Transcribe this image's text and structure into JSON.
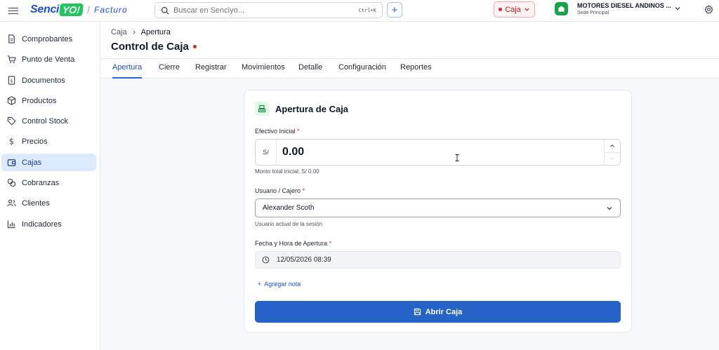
{
  "topbar": {
    "logo_text": "Senci",
    "logo_badge": "YO!",
    "logo_product": "Facturo",
    "search_placeholder": "Buscar en Senciyo...",
    "search_shortcut": "Ctrl+K",
    "caja_status": "Caja",
    "company_name": "MOTORES DIESEL ANDINOS ...",
    "company_branch": "Sede Principal"
  },
  "sidebar": {
    "items": [
      {
        "label": "Comprobantes",
        "icon": "file-text-icon"
      },
      {
        "label": "Punto de Venta",
        "icon": "cart-icon"
      },
      {
        "label": "Documentos",
        "icon": "dollar-document-icon"
      },
      {
        "label": "Productos",
        "icon": "box-icon"
      },
      {
        "label": "Control Stock",
        "icon": "tag-icon"
      },
      {
        "label": "Precios",
        "icon": "dollar-icon"
      },
      {
        "label": "Cajas",
        "icon": "wallet-icon"
      },
      {
        "label": "Cobranzas",
        "icon": "coins-icon"
      },
      {
        "label": "Clientes",
        "icon": "users-icon"
      },
      {
        "label": "Indicadores",
        "icon": "bar-chart-icon"
      }
    ],
    "active": "Cajas"
  },
  "header": {
    "breadcrumb": [
      "Caja",
      "Apertura"
    ],
    "title": "Control de Caja"
  },
  "tabs": [
    "Apertura",
    "Cierre",
    "Registrar",
    "Movimientos",
    "Detalle",
    "Configuración",
    "Reportes"
  ],
  "active_tab": "Apertura",
  "form": {
    "title": "Apertura de Caja",
    "efectivo_label": "Efectivo Inicial",
    "currency": "S/",
    "efectivo_value": "0.00",
    "efectivo_help": "Monto total inicial: S/ 0.00",
    "usuario_label": "Usuario / Cajero",
    "usuario_value": "Alexander Scoth",
    "usuario_help": "Usuario actual de la sesión",
    "fecha_label": "Fecha y Hora de Apertura",
    "fecha_value": "12/05/2026 08:39",
    "add_note": "Agregar nota",
    "submit": "Abrir Caja"
  },
  "colors": {
    "primary": "#2563c7",
    "active_bg": "#dbeafe",
    "status_red": "#dc2626",
    "brand_green": "#22c55e"
  }
}
